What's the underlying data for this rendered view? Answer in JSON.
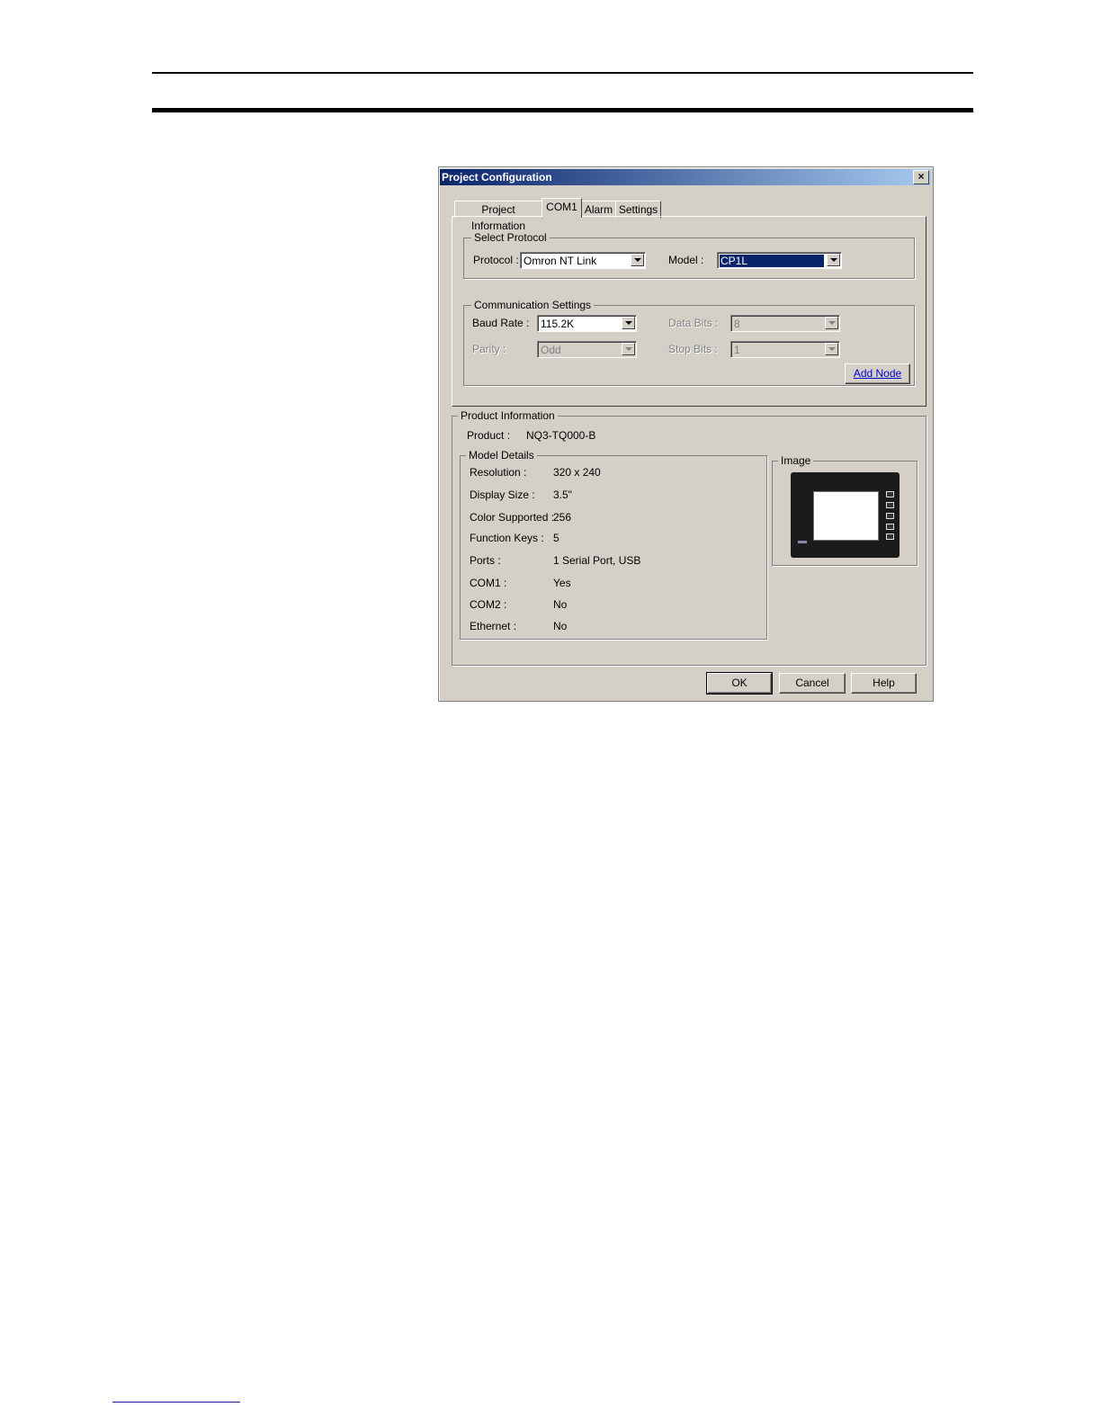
{
  "dialog": {
    "title": "Project Configuration",
    "close_glyph": "×"
  },
  "tabs": [
    {
      "label": "Project Information",
      "active": false
    },
    {
      "label": "COM1",
      "active": true
    },
    {
      "label": "Alarm",
      "active": false
    },
    {
      "label": "Settings",
      "active": false
    }
  ],
  "select_protocol": {
    "group_label": "Select Protocol",
    "protocol_label": "Protocol :",
    "protocol_value": "Omron NT Link",
    "model_label": "Model :",
    "model_value": "CP1L"
  },
  "comm_settings": {
    "group_label": "Communication Settings",
    "baud_label": "Baud Rate :",
    "baud_value": "115.2K",
    "data_bits_label": "Data Bits :",
    "data_bits_value": "8",
    "parity_label": "Parity :",
    "parity_value": "Odd",
    "stop_bits_label": "Stop Bits :",
    "stop_bits_value": "1",
    "add_node_label": "Add Node"
  },
  "product_info": {
    "group_label": "Product Information",
    "product_label": "Product :",
    "product_value": "NQ3-TQ000-B",
    "model_details_label": "Model Details",
    "image_label": "Image",
    "details": [
      {
        "key": "Resolution :",
        "value": "320 x 240"
      },
      {
        "key": "Display Size :",
        "value": "3.5\""
      },
      {
        "key": "Color Supported :",
        "value": "256"
      },
      {
        "key": "Function Keys :",
        "value": "5"
      },
      {
        "key": "Ports :",
        "value": "1 Serial Port, USB"
      },
      {
        "key": "COM1 :",
        "value": "Yes"
      },
      {
        "key": "COM2 :",
        "value": "No"
      },
      {
        "key": "Ethernet :",
        "value": "No"
      }
    ]
  },
  "buttons": {
    "ok": "OK",
    "cancel": "Cancel",
    "help": "Help"
  },
  "colors": {
    "titlebar_start": "#0a246a",
    "titlebar_end": "#a6caf0",
    "dialog_face": "#d4d0c8",
    "selection": "#0a246a",
    "link": "#0000cc"
  }
}
